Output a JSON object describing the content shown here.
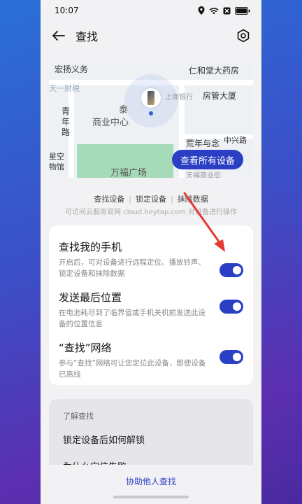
{
  "status": {
    "time": "10:07"
  },
  "header": {
    "title": "查找"
  },
  "map": {
    "labels": [
      "宏扬义务",
      "仁和堂大药房",
      "天一财税",
      "上商银行",
      "房管大厦",
      "青年路",
      "泰",
      "商业中心",
      "荒年与念",
      "中兴路",
      "星空物馆",
      "万福广场",
      "天福商业街"
    ],
    "see_all_label": "查看所有设备"
  },
  "actions": {
    "find": "查找设备",
    "lock": "锁定设备",
    "erase": "抹除数据"
  },
  "hint": "可访问云服务官网 cloud.heytap.com 对设备进行操作",
  "settings": [
    {
      "title": "查找我的手机",
      "desc": "开启后，可对设备进行远程定位、播放铃声、锁定设备和抹除数据",
      "on": true
    },
    {
      "title": "发送最后位置",
      "desc": "在电池耗尽到了临界值或手机关机前发送此设备的位置信息",
      "on": true
    },
    {
      "title": "“查找”网络",
      "desc": "参与“查找”网络可让您定位此设备，即使设备已离线",
      "on": true
    }
  ],
  "learn": {
    "title": "了解查找",
    "items": [
      "锁定设备后如何解锁",
      "为什么定位失败"
    ]
  },
  "footer": {
    "help": "协助他人查找"
  },
  "colors": {
    "accent": "#2a3fc4",
    "annotation_arrow": "#e53935"
  }
}
